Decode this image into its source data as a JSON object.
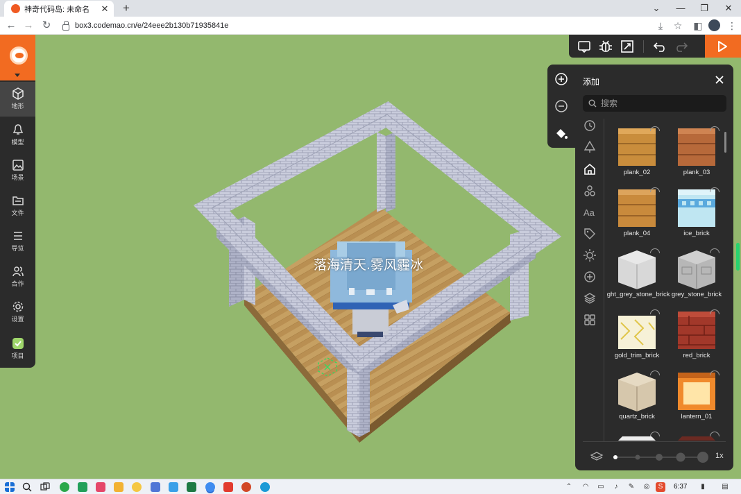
{
  "browser": {
    "tab_title": "神奇代码岛: 未命名",
    "url": "box3.codemao.cn/e/24eee2b130b71935841e"
  },
  "sidebar": {
    "items": [
      {
        "label": "地形",
        "icon": "cube-icon",
        "active": true
      },
      {
        "label": "模型",
        "icon": "bell-icon",
        "active": false
      },
      {
        "label": "场景",
        "icon": "image-icon",
        "active": false
      },
      {
        "label": "文件",
        "icon": "folder-icon",
        "active": false
      },
      {
        "label": "导览",
        "icon": "list-icon",
        "active": false
      },
      {
        "label": "合作",
        "icon": "users-icon",
        "active": false
      },
      {
        "label": "设置",
        "icon": "gear-icon",
        "active": false
      },
      {
        "label": "项目",
        "icon": "project-icon",
        "active": false
      }
    ]
  },
  "scene": {
    "overlay_label": "落海清天.雾风霾冰"
  },
  "panel": {
    "title": "添加",
    "search_placeholder": "搜索",
    "zoom_level": "1x",
    "items": [
      {
        "name": "plank_02"
      },
      {
        "name": "plank_03"
      },
      {
        "name": "plank_04"
      },
      {
        "name": "ice_brick"
      },
      {
        "name": "light_grey_stone_brick"
      },
      {
        "name": "grey_stone_brick"
      },
      {
        "name": "gold_trim_brick"
      },
      {
        "name": "red_brick"
      },
      {
        "name": "quartz_brick"
      },
      {
        "name": "lantern_01"
      }
    ]
  },
  "taskbar": {
    "time": "6:37"
  },
  "colors": {
    "accent": "#f26b21",
    "dark_panel": "#2b2b2b",
    "grass": "#92b76d"
  }
}
